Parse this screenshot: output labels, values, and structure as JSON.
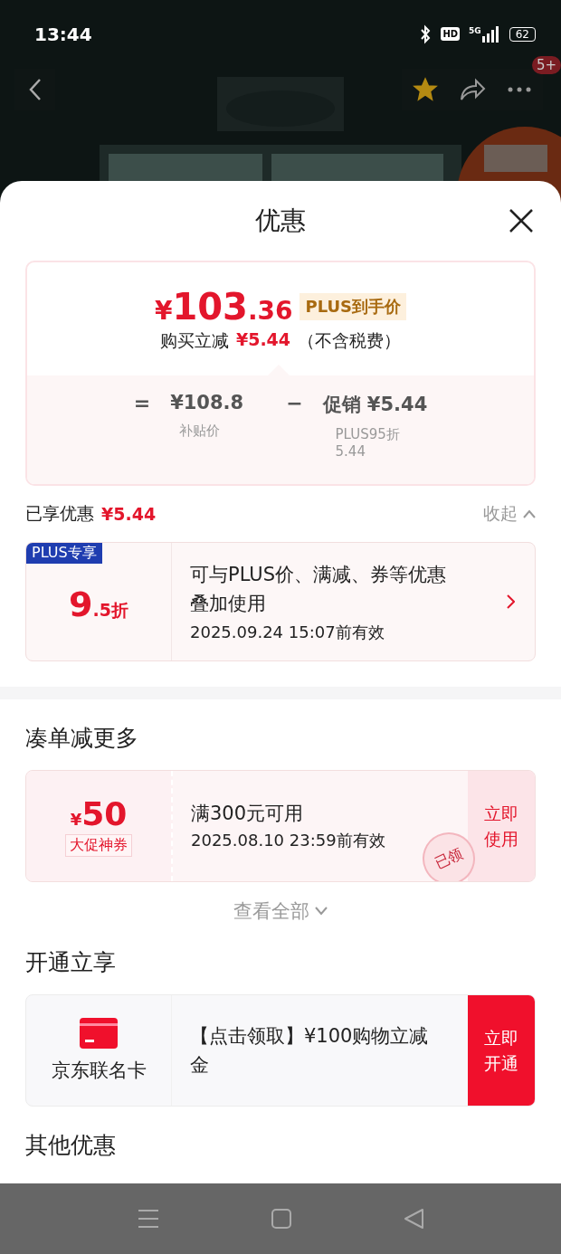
{
  "status_bar": {
    "time": "13:44",
    "hd": "HD",
    "network": "5G",
    "battery": "62"
  },
  "nav": {
    "badge": "5+",
    "favorited": true
  },
  "sheet": {
    "title": "优惠"
  },
  "price_card": {
    "currency": "¥",
    "integer": "103",
    "decimals": ".36",
    "tag": "PLUS到手价",
    "reduce_label": "购买立减",
    "reduce_amount": "¥5.44",
    "tax_note": "（不含税费）",
    "breakdown": [
      {
        "sign": "=",
        "amount": "¥108.8",
        "note": "补贴价"
      },
      {
        "sign": "−",
        "amount": "促销 ¥5.44",
        "note": "PLUS95折 5.44"
      }
    ]
  },
  "enjoyed": {
    "label": "已享优惠",
    "amount": "¥5.44",
    "toggle": "收起",
    "expanded": true
  },
  "plus_discount": {
    "tag": "PLUS专享",
    "value_main": "9",
    "value_rest": ".5折",
    "description": "可与PLUS价、满减、券等优惠叠加使用",
    "validity": "2025.09.24 15:07前有效"
  },
  "sections": [
    {
      "kind": "coupons",
      "title": "凑单减更多",
      "coupon": {
        "currency": "¥",
        "amount": "50",
        "type": "大促神券",
        "condition": "满300元可用",
        "validity": "2025.08.10 23:59前有效",
        "action": "立即使用",
        "stamp": "已领"
      },
      "view_all": {
        "label": "查看全部",
        "expanded": false
      }
    },
    {
      "kind": "card",
      "title": "开通立享",
      "offer": {
        "name": "京东联名卡",
        "description": "【点击领取】¥100购物立减金",
        "action": "立即开通"
      }
    },
    {
      "kind": "heading",
      "title": "其他优惠"
    }
  ]
}
